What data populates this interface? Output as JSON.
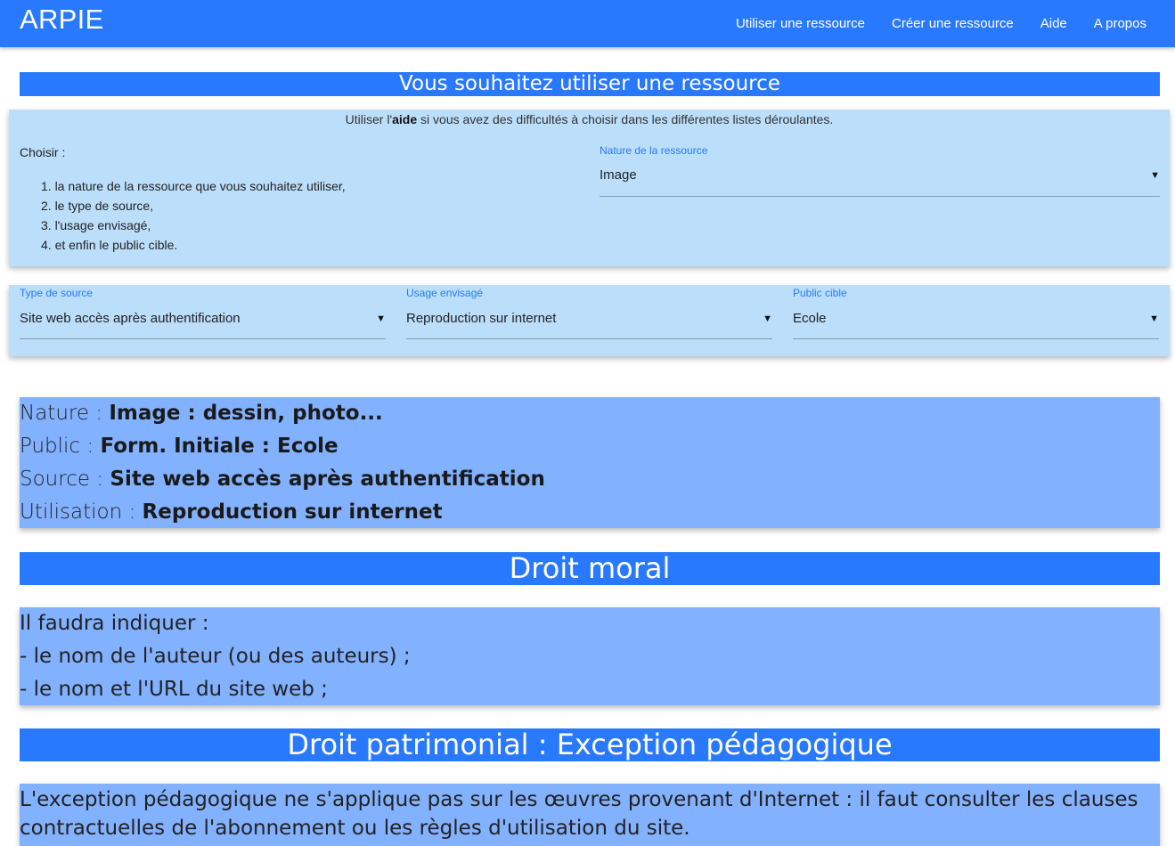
{
  "nav": {
    "brand": "ARPIE",
    "links": [
      "Utiliser une ressource",
      "Créer une ressource",
      "Aide",
      "A propos"
    ]
  },
  "sections": {
    "use_title": "Vous souhaitez utiliser une ressource",
    "moral_title": "Droit moral",
    "patrimonial_title": "Droit patrimonial : Exception pédagogique"
  },
  "form": {
    "hint_before": "Utiliser l'",
    "hint_bold": "aide",
    "hint_after": " si vous avez des difficultés à choisir dans les différentes listes déroulantes.",
    "choose_label": "Choisir :",
    "steps": [
      "1. la nature de la ressource que vous souhaitez utiliser,",
      "2. le type de source,",
      "3. l'usage envisagé,",
      "4. et enfin le public cible."
    ],
    "nature": {
      "label": "Nature de la ressource",
      "value": "Image"
    },
    "source_type": {
      "label": "Type de source",
      "value": "Site web accès après authentification"
    },
    "usage": {
      "label": "Usage envisagé",
      "value": "Reproduction sur internet"
    },
    "audience": {
      "label": "Public cible",
      "value": "Ecole"
    }
  },
  "summary": {
    "nature_label": "Nature : ",
    "nature_value": "Image : dessin, photo...",
    "public_label": "Public : ",
    "public_value": "Form. Initiale : Ecole",
    "source_label": "Source : ",
    "source_value": "Site web accès après authentification",
    "usage_label": "Utilisation : ",
    "usage_value": "Reproduction sur internet"
  },
  "moral": {
    "lines": [
      "Il faudra indiquer :",
      "- le nom de l'auteur (ou des auteurs) ;",
      "- le nom et l'URL du site web ;"
    ]
  },
  "patrimonial": {
    "text": "L'exception pédagogique ne s'applique pas sur les œuvres provenant d'Internet : il faut consulter les clauses contractuelles de l'abonnement ou les règles d'utilisation du site."
  },
  "icons": {
    "dropdown": "triangle-down-icon"
  },
  "colors": {
    "primary": "#2979ff",
    "form_bg": "#bbdefb",
    "info_bg": "#82b1ff"
  }
}
